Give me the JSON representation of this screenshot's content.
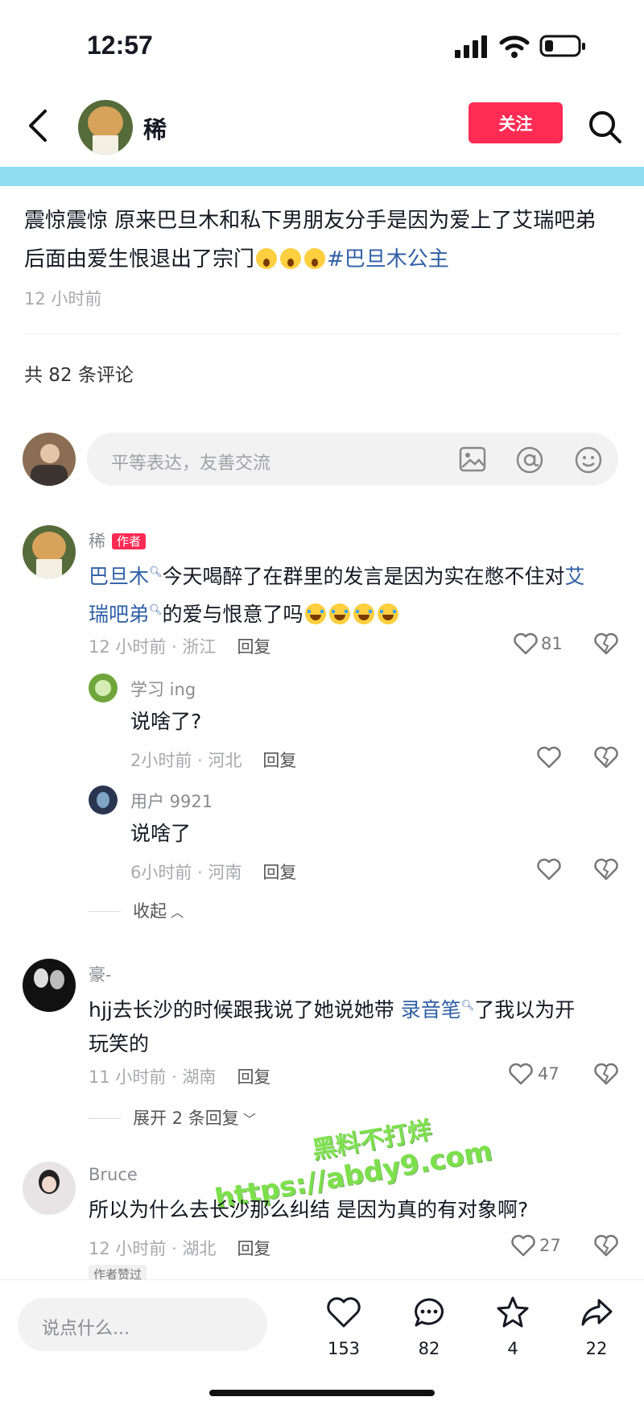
{
  "status_bar": {
    "time": "12:57"
  },
  "header": {
    "username": "稀",
    "follow_label": "关注"
  },
  "post": {
    "text": "震惊震惊 原来巴旦木和私下男朋友分手是因为爱上了艾瑞吧弟后面由爱生恨退出了宗门",
    "text_line1": "震惊震惊 原来巴旦木和私下男朋友分手是因为爱上了艾瑞吧弟",
    "text_line2": "后面由爱生恨退出了宗门",
    "hashtag": "#巴旦木公主",
    "time": "12 小时前"
  },
  "comments_count_label": "共 82 条评论",
  "comment_input": {
    "placeholder": "平等表达，友善交流"
  },
  "comments": [
    {
      "user": "稀",
      "badge": "作者",
      "link1": "巴旦木",
      "mid": "今天喝醉了在群里的发言是因为实在憋不住对",
      "link2_a": "艾",
      "link2_b": "瑞吧弟",
      "tail": "的爱与恨意了吗",
      "meta": "12 小时前 · 浙江",
      "reply": "回复",
      "likes": "81",
      "replies": [
        {
          "user": "学习 ing",
          "text": "说啥了?",
          "meta": "2小时前 · 河北",
          "reply": "回复"
        },
        {
          "user": "用户 9921",
          "text": "说啥了",
          "meta": "6小时前 · 河南",
          "reply": "回复"
        }
      ],
      "collapse": "收起"
    },
    {
      "user": "豪-",
      "pre": "hjj去长沙的时候跟我说了她说她带 ",
      "link": "录音笔",
      "post": "了我以为开",
      "line2": "玩笑的",
      "meta": "11 小时前 · 湖南",
      "reply": "回复",
      "likes": "47",
      "expand": "展开 2 条回复"
    },
    {
      "user": "Bruce",
      "text": "所以为什么去长沙那么纠结  是因为真的有对象啊?",
      "meta": "12 小时前 · 湖北",
      "reply": "回复",
      "likes": "27",
      "author_liked": "作者赞过"
    }
  ],
  "watermark": {
    "line1": "黑料不打烊",
    "line2": "https://abdy9.com"
  },
  "bottom_bar": {
    "input_placeholder": "说点什么...",
    "likes": "153",
    "comments": "82",
    "favorites": "4",
    "shares": "22"
  }
}
